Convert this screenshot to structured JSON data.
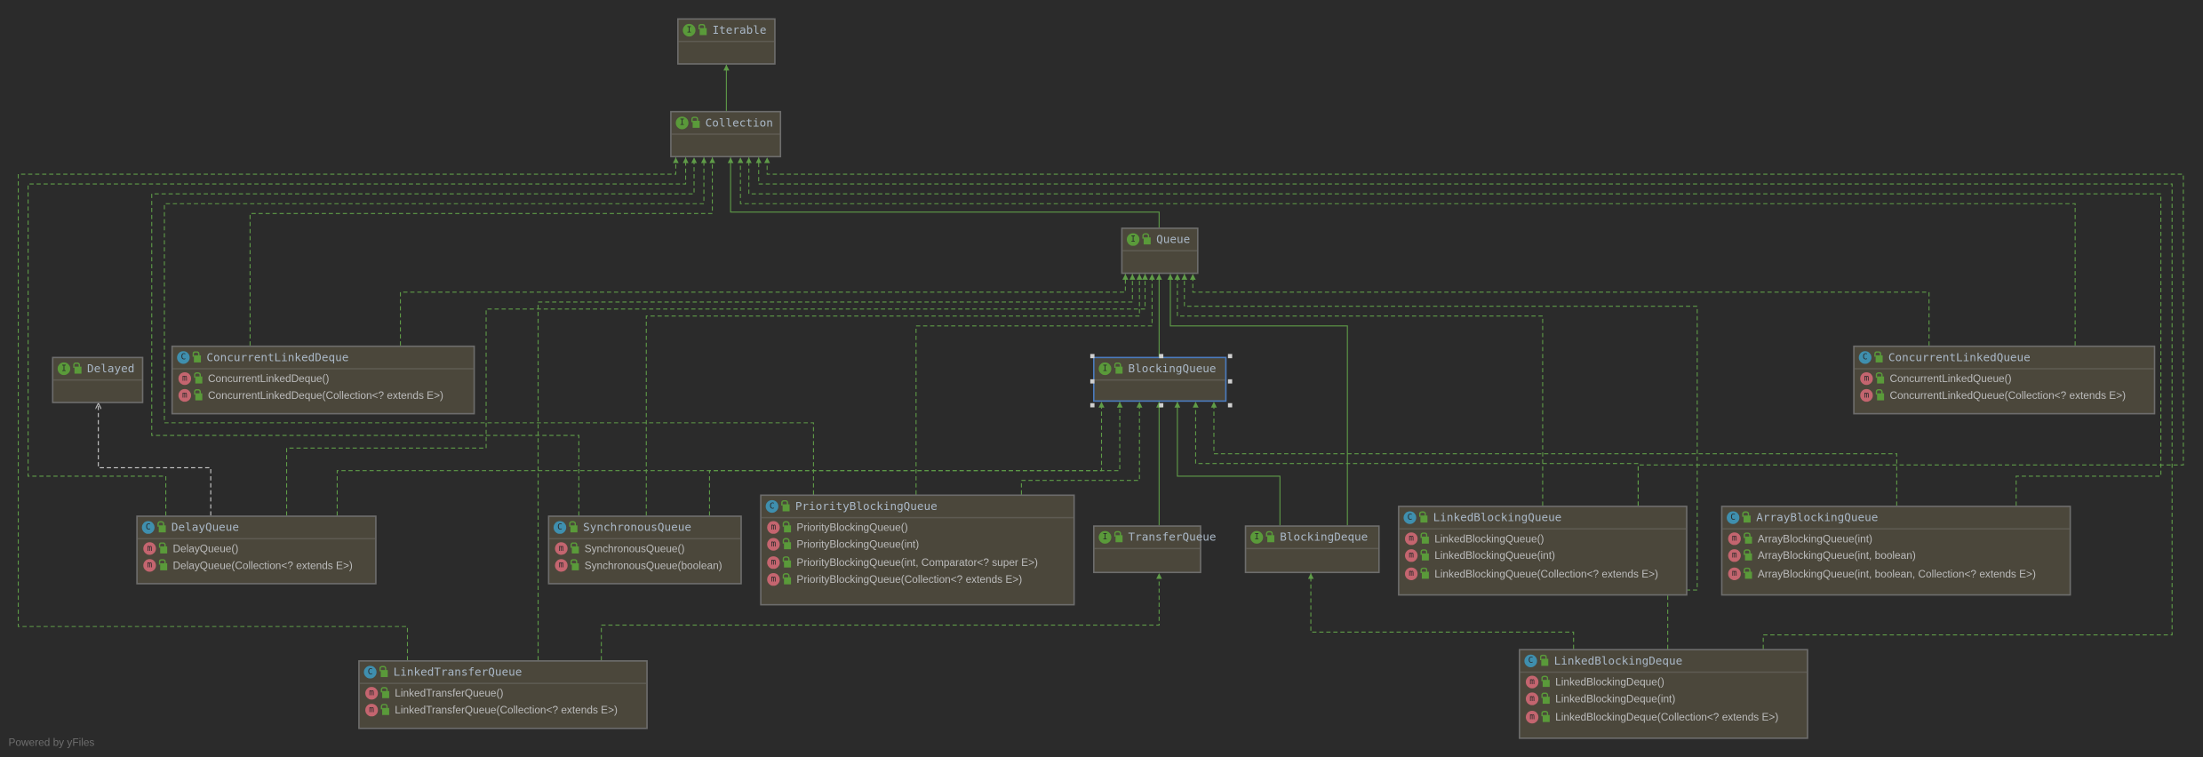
{
  "diagram": {
    "nodes": [
      {
        "name": "Iterable",
        "kind": "interface",
        "badge": "I",
        "members": []
      },
      {
        "name": "Collection",
        "kind": "interface",
        "badge": "I",
        "members": []
      },
      {
        "name": "Queue",
        "kind": "interface",
        "badge": "I",
        "members": []
      },
      {
        "name": "BlockingQueue",
        "kind": "interface",
        "badge": "I",
        "selected": true,
        "members": []
      },
      {
        "name": "Delayed",
        "kind": "interface",
        "badge": "I",
        "members": []
      },
      {
        "name": "ConcurrentLinkedDeque",
        "kind": "class",
        "badge": "C",
        "members": [
          "ConcurrentLinkedDeque()",
          "ConcurrentLinkedDeque(Collection<? extends E>)"
        ]
      },
      {
        "name": "ConcurrentLinkedQueue",
        "kind": "class",
        "badge": "C",
        "members": [
          "ConcurrentLinkedQueue()",
          "ConcurrentLinkedQueue(Collection<? extends E>)"
        ]
      },
      {
        "name": "DelayQueue",
        "kind": "class",
        "badge": "C",
        "members": [
          "DelayQueue()",
          "DelayQueue(Collection<? extends E>)"
        ]
      },
      {
        "name": "SynchronousQueue",
        "kind": "class",
        "badge": "C",
        "members": [
          "SynchronousQueue()",
          "SynchronousQueue(boolean)"
        ]
      },
      {
        "name": "PriorityBlockingQueue",
        "kind": "class",
        "badge": "C",
        "members": [
          "PriorityBlockingQueue()",
          "PriorityBlockingQueue(int)",
          "PriorityBlockingQueue(int, Comparator<? super E>)",
          "PriorityBlockingQueue(Collection<? extends E>)"
        ]
      },
      {
        "name": "TransferQueue",
        "kind": "interface",
        "badge": "I",
        "members": []
      },
      {
        "name": "BlockingDeque",
        "kind": "interface",
        "badge": "I",
        "members": []
      },
      {
        "name": "LinkedBlockingQueue",
        "kind": "class",
        "badge": "C",
        "members": [
          "LinkedBlockingQueue()",
          "LinkedBlockingQueue(int)",
          "LinkedBlockingQueue(Collection<? extends E>)"
        ]
      },
      {
        "name": "ArrayBlockingQueue",
        "kind": "class",
        "badge": "C",
        "members": [
          "ArrayBlockingQueue(int)",
          "ArrayBlockingQueue(int, boolean)",
          "ArrayBlockingQueue(int, boolean, Collection<? extends E>)"
        ]
      },
      {
        "name": "LinkedTransferQueue",
        "kind": "class",
        "badge": "C",
        "members": [
          "LinkedTransferQueue()",
          "LinkedTransferQueue(Collection<? extends E>)"
        ]
      },
      {
        "name": "LinkedBlockingDeque",
        "kind": "class",
        "badge": "C",
        "members": [
          "LinkedBlockingDeque()",
          "LinkedBlockingDeque(int)",
          "LinkedBlockingDeque(Collection<? extends E>)"
        ]
      }
    ],
    "method_badge": "m"
  },
  "colors": {
    "background": "#2b2b2b",
    "node_fill": "#4b473b",
    "extends_edge": "#5f9c48",
    "implements_edge": "#5f9c48",
    "selection_border": "#4a7bbf",
    "interface_badge": "#5a9a3a",
    "class_badge": "#3f8fae",
    "method_badge": "#c4656f"
  },
  "footer": {
    "text": "Powered by yFiles"
  }
}
